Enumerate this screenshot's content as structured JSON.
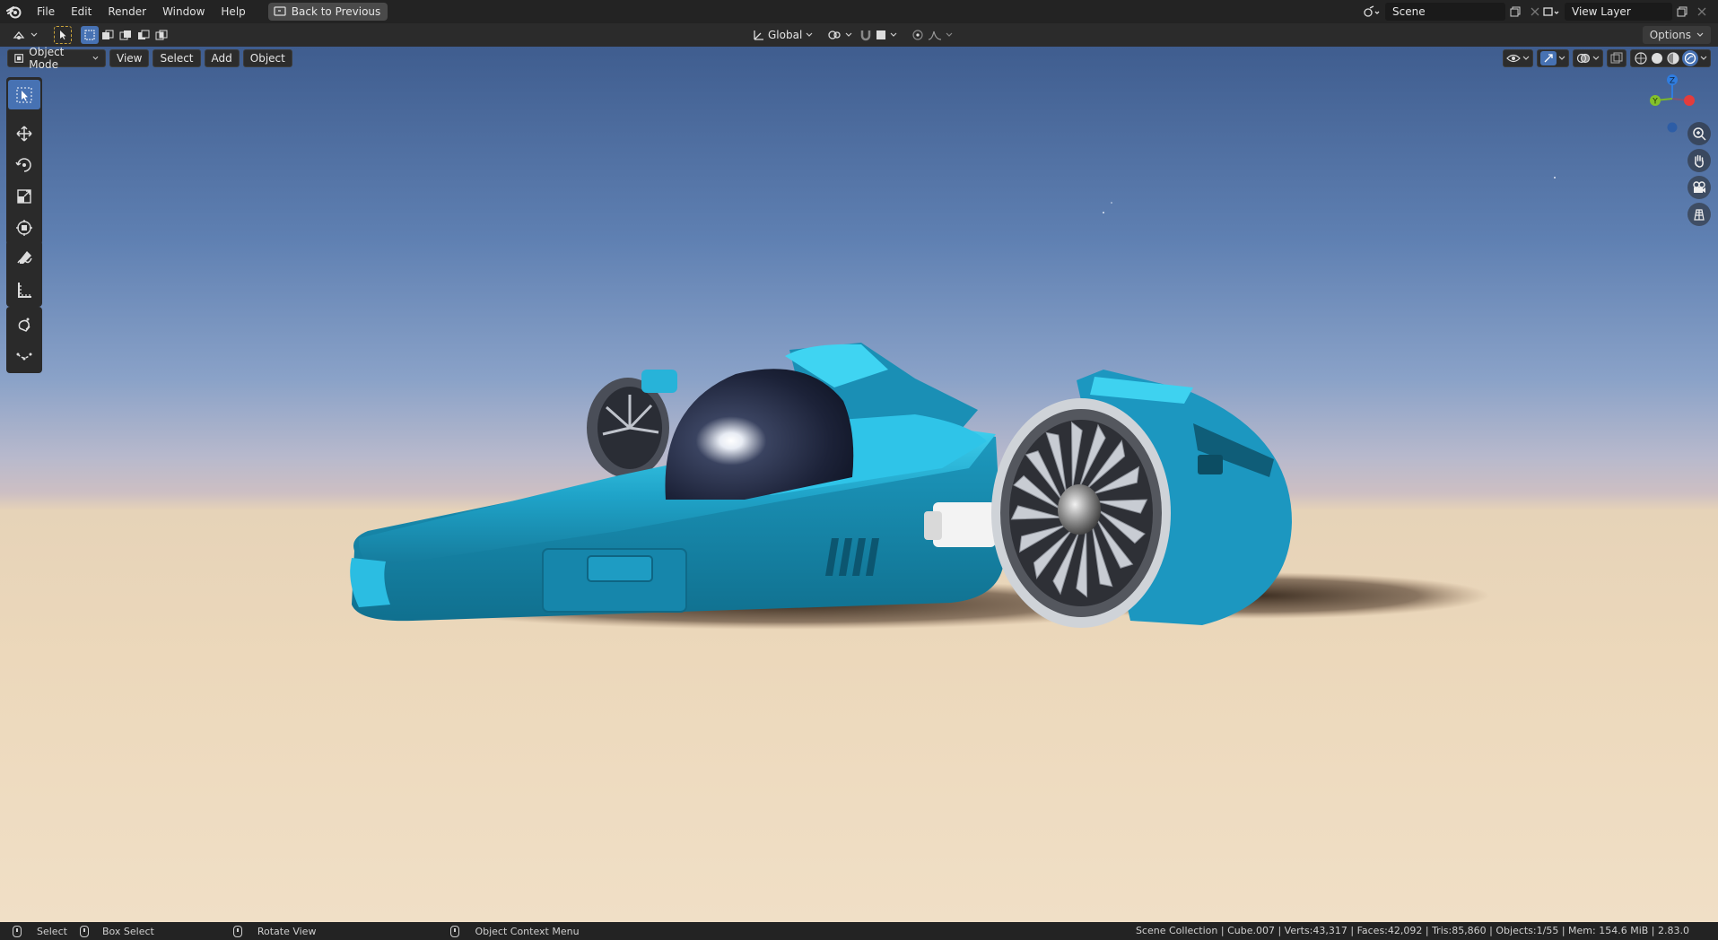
{
  "menubar": {
    "items": [
      "File",
      "Edit",
      "Render",
      "Window",
      "Help"
    ],
    "back_button": "Back to Previous",
    "scene": "Scene",
    "view_layer": "View Layer"
  },
  "toolbar": {
    "transform_orientation": "Global",
    "options_label": "Options"
  },
  "viewport": {
    "mode": "Object Mode",
    "menus": [
      "View",
      "Select",
      "Add",
      "Object"
    ],
    "gizmo_axes": {
      "z": "Z",
      "y": "Y"
    },
    "accent": "#4772b3",
    "vehicle_color": "#1fa3c8"
  },
  "tools": [
    "select-box",
    "cursor",
    "move",
    "rotate",
    "scale",
    "transform",
    "annotate",
    "measure",
    "add-cube",
    "extrude"
  ],
  "statusbar": {
    "select": "Select",
    "box_select": "Box Select",
    "rotate_view": "Rotate View",
    "context_menu": "Object Context Menu",
    "stats": "Scene Collection | Cube.007 | Verts:43,317 | Faces:42,092 | Tris:85,860 | Objects:1/55 | Mem: 154.6 MiB | 2.83.0"
  }
}
